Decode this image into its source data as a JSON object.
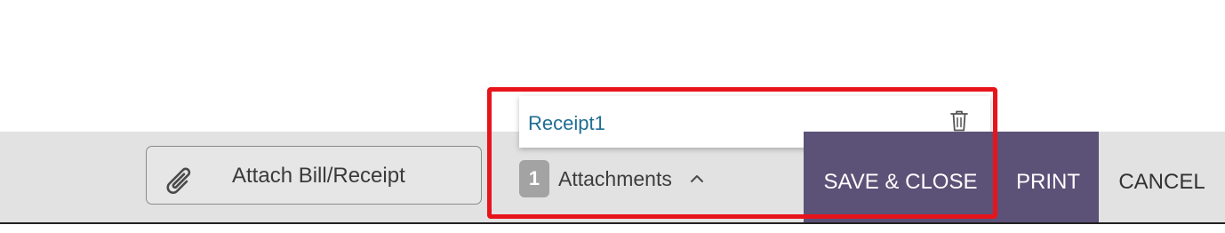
{
  "footer": {
    "attach_button_label": "Attach Bill/Receipt",
    "attachments_count": "1",
    "attachments_label": "Attachments",
    "save_close_label": "SAVE & CLOSE",
    "print_label": "PRINT",
    "cancel_label": "CANCEL"
  },
  "popup": {
    "items": [
      {
        "name": "Receipt1"
      }
    ]
  },
  "icons": {
    "attach": "paperclip-icon",
    "toggle": "chevron-up-icon",
    "delete": "trash-icon"
  },
  "colors": {
    "accent": "#5c5177",
    "link": "#1f6d94",
    "highlight": "#e8141b",
    "footer_bg": "#e2e2e2"
  }
}
